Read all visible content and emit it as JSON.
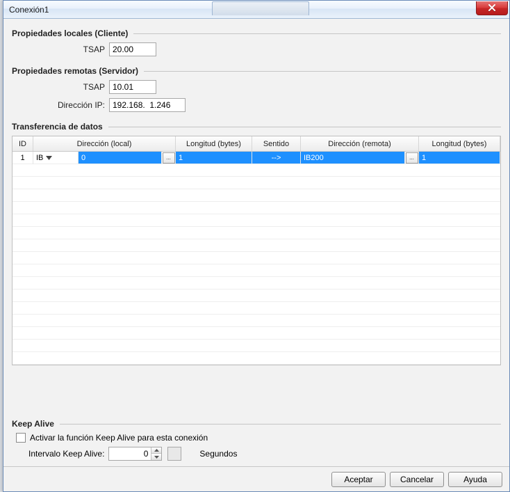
{
  "window": {
    "title": "Conexión1"
  },
  "local": {
    "group_title": "Propiedades locales (Cliente)",
    "tsap_label": "TSAP",
    "tsap_value": "20.00"
  },
  "remote": {
    "group_title": "Propiedades remotas (Servidor)",
    "tsap_label": "TSAP",
    "tsap_value": "10.01",
    "ip_label": "Dirección IP:",
    "ip_value": "192.168.  1.246"
  },
  "transfer": {
    "group_title": "Transferencia de datos",
    "headers": {
      "id": "ID",
      "dir_local": "Dirección (local)",
      "len_local": "Longitud (bytes)",
      "sense": "Sentido",
      "dir_remote": "Dirección (remota)",
      "len_remote": "Longitud (bytes)"
    },
    "row": {
      "id": "1",
      "type": "IB",
      "local_offset": "0",
      "len_local": "1",
      "sense": "-->",
      "dir_remote": "IB200",
      "len_remote": "1"
    }
  },
  "keepalive": {
    "group_title": "Keep Alive",
    "checkbox_label": "Activar la función Keep Alive para esta conexión",
    "interval_label": "Intervalo Keep Alive:",
    "interval_value": "0",
    "unit_label": "Segundos"
  },
  "footer": {
    "accept": "Aceptar",
    "cancel": "Cancelar",
    "help": "Ayuda"
  },
  "icons": {
    "dots": "...",
    "dropdown": "▼"
  }
}
